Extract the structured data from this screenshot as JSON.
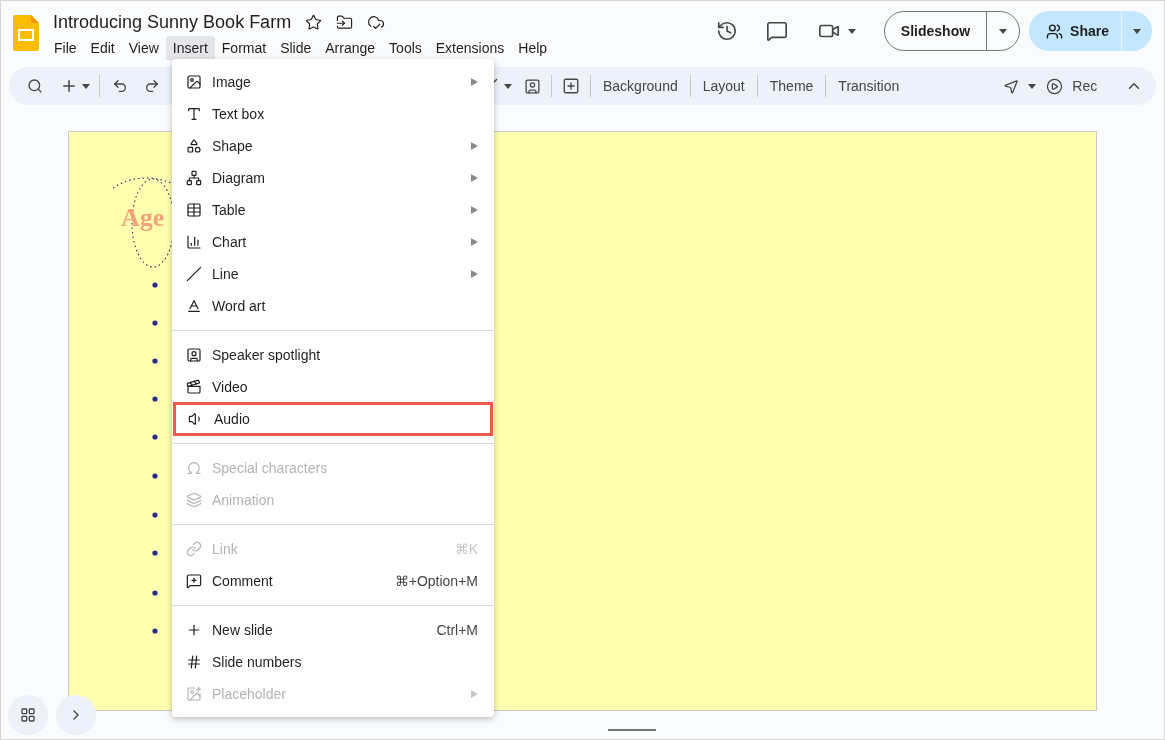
{
  "document": {
    "title": "Introducing Sunny Book Farm"
  },
  "menubar": [
    {
      "label": "File",
      "selected": false
    },
    {
      "label": "Edit",
      "selected": false
    },
    {
      "label": "View",
      "selected": false
    },
    {
      "label": "Insert",
      "selected": true
    },
    {
      "label": "Format",
      "selected": false
    },
    {
      "label": "Slide",
      "selected": false
    },
    {
      "label": "Arrange",
      "selected": false
    },
    {
      "label": "Tools",
      "selected": false
    },
    {
      "label": "Extensions",
      "selected": false
    },
    {
      "label": "Help",
      "selected": false
    }
  ],
  "header": {
    "slideshow": "Slideshow",
    "share": "Share"
  },
  "toolbar": {
    "buttons": [
      "Background",
      "Layout",
      "Theme",
      "Transition"
    ],
    "record": "Rec"
  },
  "slide": {
    "title": "Age"
  },
  "insert_menu": {
    "groups": [
      [
        {
          "label": "Image",
          "submenu": true,
          "disabled": false,
          "highlighted": false
        },
        {
          "label": "Text box",
          "submenu": false,
          "disabled": false,
          "highlighted": false
        },
        {
          "label": "Shape",
          "submenu": true,
          "disabled": false,
          "highlighted": false
        },
        {
          "label": "Diagram",
          "submenu": true,
          "disabled": false,
          "highlighted": false
        },
        {
          "label": "Table",
          "submenu": true,
          "disabled": false,
          "highlighted": false
        },
        {
          "label": "Chart",
          "submenu": true,
          "disabled": false,
          "highlighted": false
        },
        {
          "label": "Line",
          "submenu": true,
          "disabled": false,
          "highlighted": false
        },
        {
          "label": "Word art",
          "submenu": false,
          "disabled": false,
          "highlighted": false
        }
      ],
      [
        {
          "label": "Speaker spotlight",
          "submenu": false,
          "disabled": false,
          "highlighted": false
        },
        {
          "label": "Video",
          "submenu": false,
          "disabled": false,
          "highlighted": false
        },
        {
          "label": "Audio",
          "submenu": false,
          "disabled": false,
          "highlighted": true
        }
      ],
      [
        {
          "label": "Special characters",
          "submenu": false,
          "disabled": true,
          "highlighted": false
        },
        {
          "label": "Animation",
          "submenu": false,
          "disabled": true,
          "highlighted": false
        }
      ],
      [
        {
          "label": "Link",
          "shortcut": "⌘K",
          "submenu": false,
          "disabled": true,
          "highlighted": false
        },
        {
          "label": "Comment",
          "shortcut": "⌘+Option+M",
          "submenu": false,
          "disabled": false,
          "highlighted": false
        }
      ],
      [
        {
          "label": "New slide",
          "shortcut": "Ctrl+M",
          "submenu": false,
          "disabled": false,
          "highlighted": false
        },
        {
          "label": "Slide numbers",
          "submenu": false,
          "disabled": false,
          "highlighted": false
        },
        {
          "label": "Placeholder",
          "submenu": true,
          "disabled": true,
          "highlighted": false
        }
      ]
    ]
  }
}
